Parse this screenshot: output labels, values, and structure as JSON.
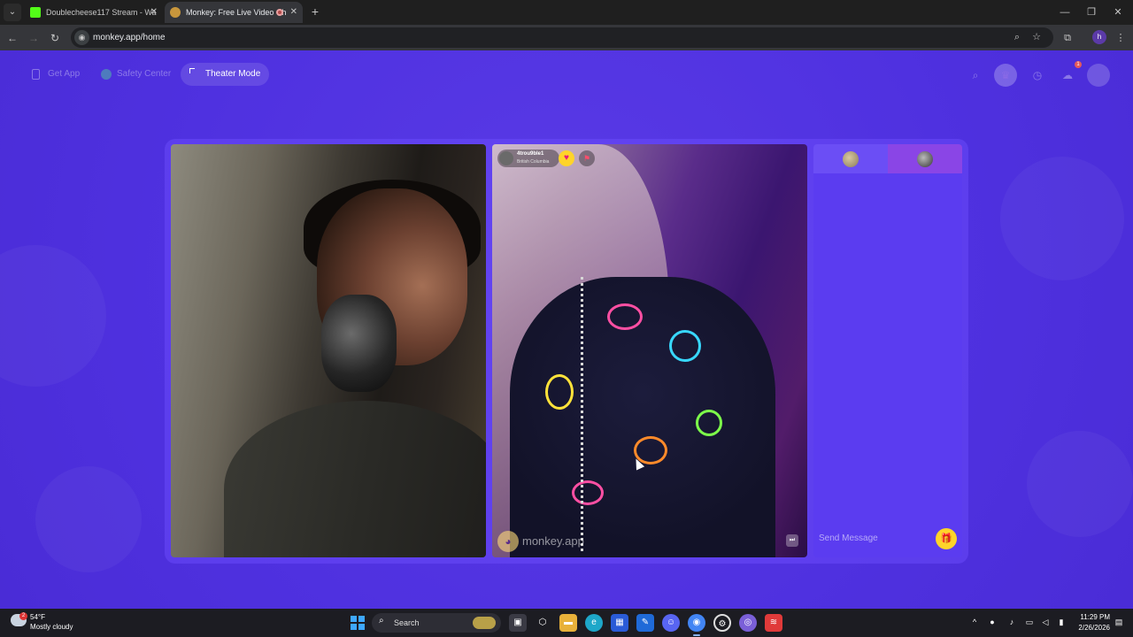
{
  "browser": {
    "tabs": [
      {
        "title": "Doublecheese117 Stream - Wa",
        "favicon_color": "#53fc18",
        "active": false
      },
      {
        "title": "Monkey: Free Live Video Ch",
        "favicon_color": "#c8963c",
        "active": true
      }
    ],
    "url": "monkey.app/home",
    "profile_initial": "h"
  },
  "page": {
    "topnav": {
      "get_app": "Get App",
      "safety_center": "Safety Center",
      "theater_mode": "Theater Mode"
    },
    "notification_count": "1",
    "remote_user": {
      "name": "4trou9ble1",
      "location": "British Columbia"
    },
    "watermark": "monkey.app",
    "chat": {
      "placeholder": "Send Message"
    }
  },
  "taskbar": {
    "weather": {
      "temp": "54°F",
      "condition": "Mostly cloudy",
      "badge": "2"
    },
    "search_label": "Search",
    "time": "11:29 PM",
    "date": "2/26/2026"
  },
  "colors": {
    "page_bg": "#4f31e0",
    "accent_yellow": "#ffd42a",
    "chat_bg": "#5b3cf0"
  }
}
